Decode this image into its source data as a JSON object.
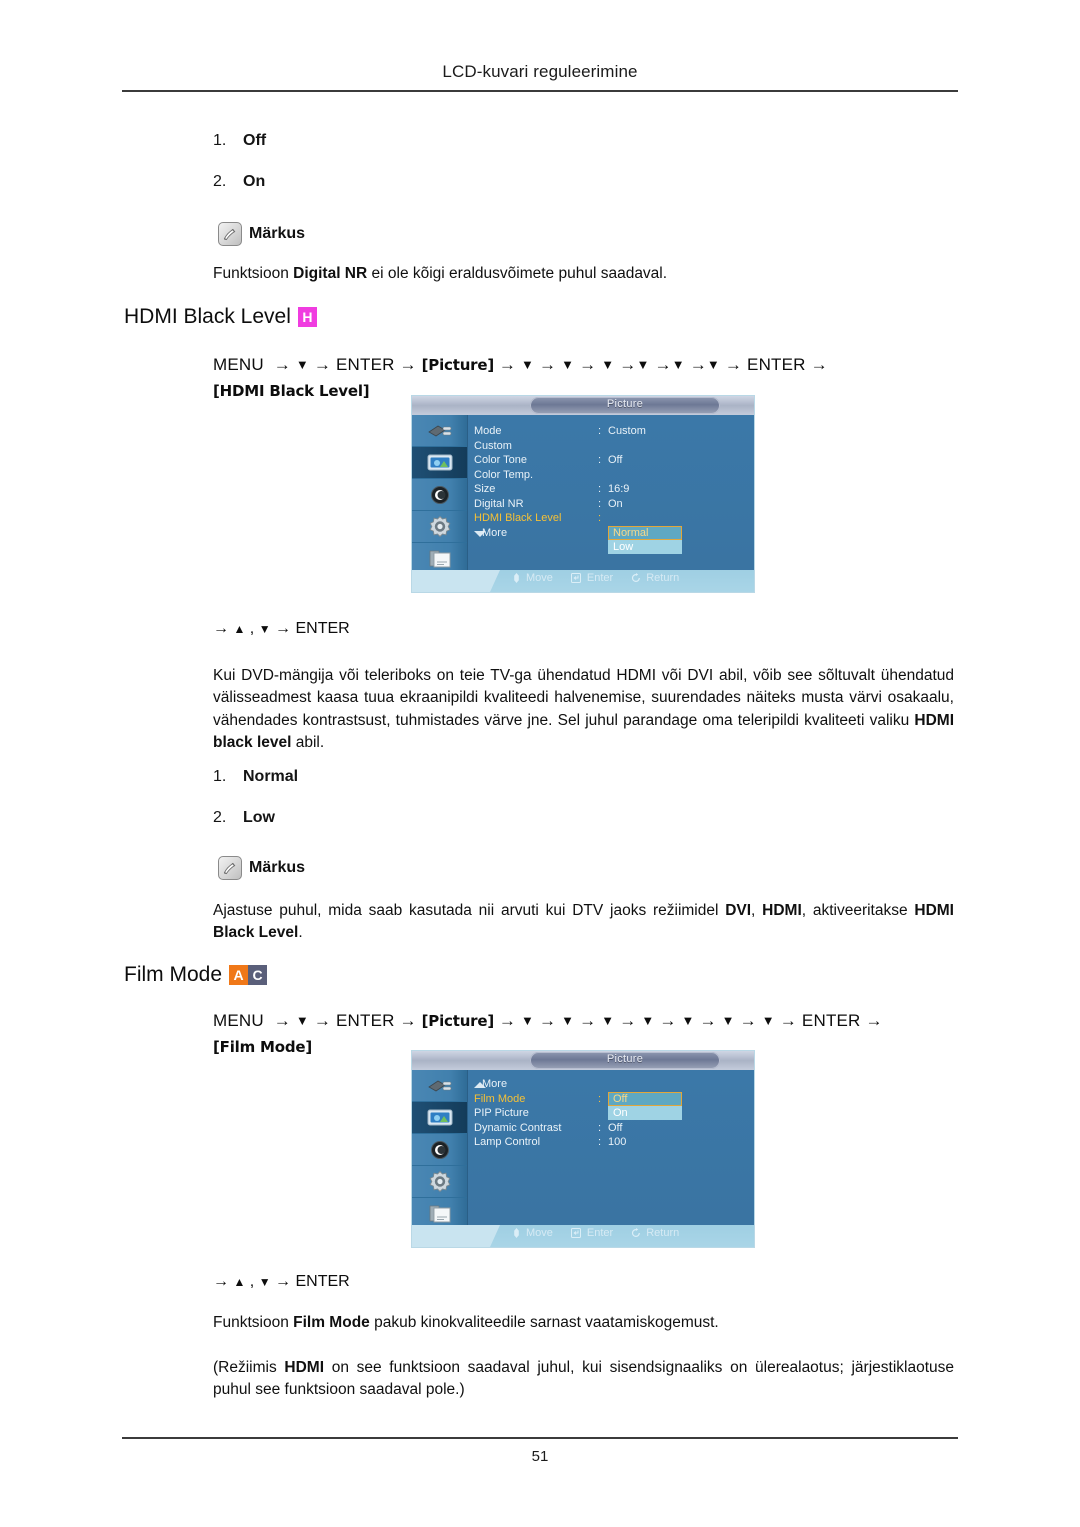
{
  "header": {
    "title": "LCD-kuvari reguleerimine"
  },
  "footer": {
    "page_number": "51"
  },
  "top_list": [
    {
      "num": "1.",
      "label": "Off"
    },
    {
      "num": "2.",
      "label": "On"
    }
  ],
  "note1": {
    "icon": "note-pen-icon",
    "label": "Märkus",
    "text_parts": [
      "Funktsioon ",
      "Digital NR",
      " ei ole kõigi eraldusvõimete puhul saadaval."
    ]
  },
  "section_hdmi": {
    "title": "HDMI Black Level",
    "badges": [
      {
        "letter": "H",
        "color": "#F03CE0"
      }
    ],
    "menupath": {
      "start": "MENU",
      "enter": "ENTER",
      "bracket_picture": "[Picture]",
      "bracket_target": "[HDMI Black Level]",
      "down_count": 6
    },
    "enter_line": ", → ENTER",
    "enter_line_label": "ENTER",
    "osd": {
      "title": "Picture",
      "rows": [
        {
          "label": "Mode",
          "colon": ":",
          "value": "Custom",
          "highlight": false
        },
        {
          "label": "Custom",
          "colon": "",
          "value": "",
          "highlight": false
        },
        {
          "label": "Color Tone",
          "colon": ":",
          "value": "Off",
          "highlight": false
        },
        {
          "label": "Color Temp.",
          "colon": "",
          "value": "",
          "highlight": false
        },
        {
          "label": "Size",
          "colon": ":",
          "value": "16:9",
          "highlight": false
        },
        {
          "label": "Digital NR",
          "colon": ":",
          "value": "On",
          "highlight": false
        },
        {
          "label": "HDMI Black Level",
          "colon": ":",
          "value": "",
          "highlight": true
        },
        {
          "label": "More",
          "colon": "",
          "value": "",
          "highlight": false,
          "caret": "down"
        }
      ],
      "dropdown": [
        {
          "label": "Normal",
          "selected": true
        },
        {
          "label": "Low",
          "selected": false
        }
      ],
      "footer": [
        {
          "icon": "move-icon",
          "label": "Move"
        },
        {
          "icon": "enter-icon",
          "label": "Enter"
        },
        {
          "icon": "return-icon",
          "label": "Return"
        }
      ]
    },
    "paragraph": [
      "Kui DVD-mängija või teleriboks on teie TV-ga ühendatud HDMI või DVI abil, võib see sõltuvalt ühendatud välisseadmest kaasa tuua ekraanipildi kvaliteedi halvenemise, suurendades näiteks musta värvi osakaalu, vähendades kontrastsust, tuhmistades värve jne. Sel juhul parandage oma teleripildi kvaliteeti valiku ",
      "HDMI black level",
      " abil."
    ],
    "options": [
      {
        "num": "1.",
        "label": "Normal"
      },
      {
        "num": "2.",
        "label": "Low"
      }
    ],
    "note": {
      "icon": "note-pen-icon",
      "label": "Märkus",
      "text_parts": [
        "Ajastuse puhul, mida saab kasutada nii arvuti kui DTV jaoks režiimidel ",
        "DVI",
        ", ",
        "HDMI",
        ", aktiveeritakse ",
        "HDMI Black Level",
        "."
      ]
    }
  },
  "section_film": {
    "title": "Film Mode",
    "badges": [
      {
        "letter": "A",
        "color": "#F07818"
      },
      {
        "letter": "C",
        "color": "#5A5F7A"
      }
    ],
    "menupath": {
      "start": "MENU",
      "enter": "ENTER",
      "bracket_picture": "[Picture]",
      "bracket_target": "[Film Mode]",
      "down_count": 7
    },
    "enter_line_label": "ENTER",
    "osd": {
      "title": "Picture",
      "rows": [
        {
          "label": "More",
          "colon": "",
          "value": "",
          "highlight": false,
          "caret": "up"
        },
        {
          "label": "Film Mode",
          "colon": ":",
          "value": "",
          "highlight": true
        },
        {
          "label": "PIP Picture",
          "colon": "",
          "value": "",
          "highlight": false
        },
        {
          "label": "Dynamic Contrast",
          "colon": ":",
          "value": "Off",
          "highlight": false
        },
        {
          "label": "Lamp Control",
          "colon": ":",
          "value": "100",
          "highlight": false
        }
      ],
      "dropdown": [
        {
          "label": "Off",
          "selected": true
        },
        {
          "label": "On",
          "selected": false
        }
      ],
      "footer": [
        {
          "icon": "move-icon",
          "label": "Move"
        },
        {
          "icon": "enter-icon",
          "label": "Enter"
        },
        {
          "icon": "return-icon",
          "label": "Return"
        }
      ]
    },
    "paragraph1": [
      "Funktsioon ",
      "Film Mode",
      " pakub kinokvaliteedile sarnast vaatamiskogemust."
    ],
    "paragraph2": [
      "(Režiimis ",
      "HDMI",
      " on see funktsioon saadaval juhul, kui sisendsignaaliks on ülerealaotus; järjestiklaotuse puhul see funktsioon saadaval pole.)"
    ]
  }
}
